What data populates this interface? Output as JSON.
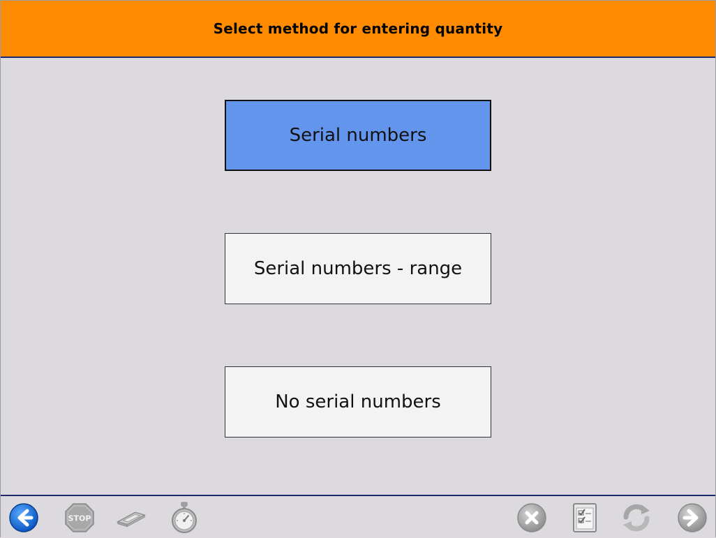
{
  "header": {
    "title": "Select method for entering quantity"
  },
  "options": [
    {
      "label": "Serial numbers",
      "selected": true
    },
    {
      "label": "Serial numbers - range",
      "selected": false
    },
    {
      "label": "No serial numbers",
      "selected": false
    }
  ],
  "footer": {
    "stop_label": "STOP",
    "left_buttons": [
      "back-arrow-icon",
      "stop-sign-icon",
      "scanner-icon",
      "stopwatch-icon"
    ],
    "right_buttons": [
      "cancel-x-icon",
      "checklist-icon",
      "refresh-icon",
      "forward-arrow-icon"
    ]
  },
  "colors": {
    "header_bg": "#ff8c00",
    "selected_bg": "#6495ed",
    "page_bg": "#dcdadf",
    "back_button": "#1e6fd9"
  }
}
